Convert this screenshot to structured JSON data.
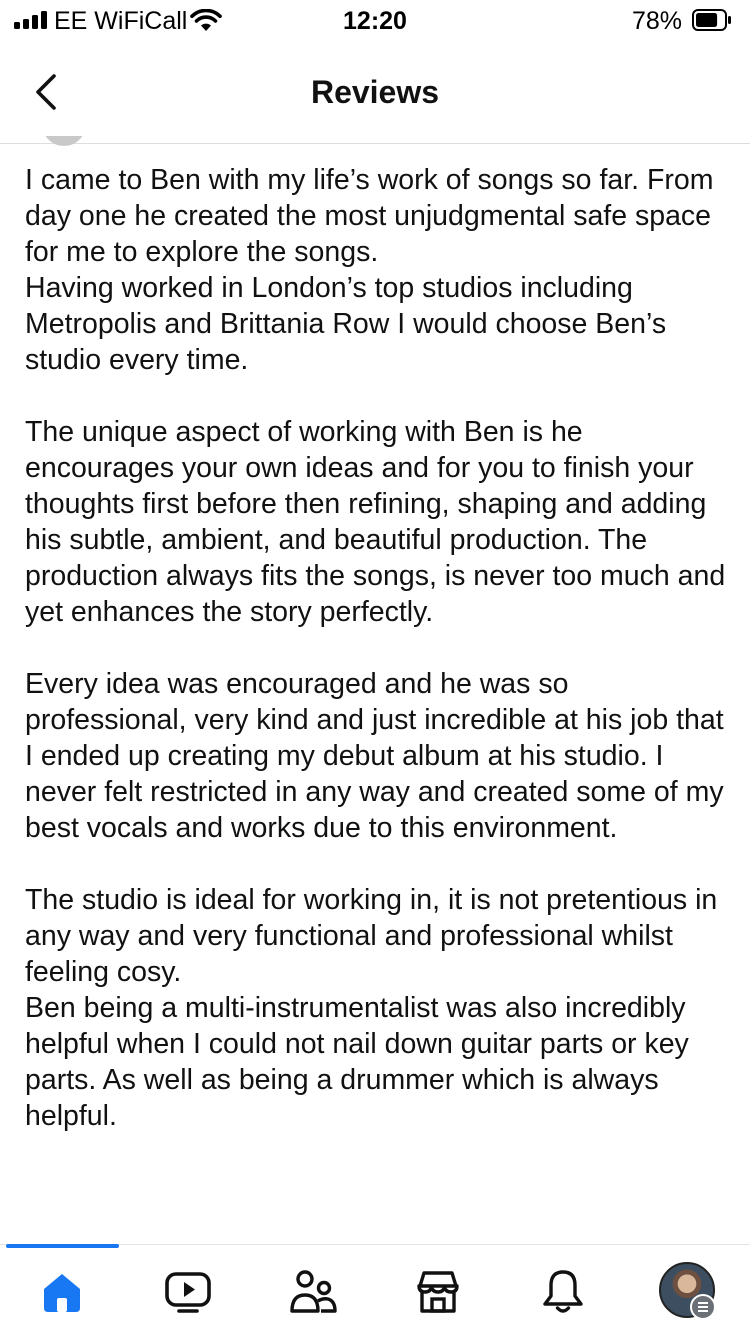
{
  "status_bar": {
    "carrier": "EE WiFiCall",
    "time": "12:20",
    "battery_percent": "78%",
    "battery_level": 0.78,
    "signal_bars": 4
  },
  "nav": {
    "title": "Reviews",
    "back_icon": "chevron-left-icon"
  },
  "review": {
    "paragraphs": [
      "I came to Ben with my life’s work of songs so far. From day one he created the most unjudgmental safe space for me to explore the songs.\nHaving worked in London’s top studios including Metropolis and Brittania Row I would choose Ben’s studio every time.",
      "The unique aspect of working with Ben is he encourages your own ideas and for you to finish your thoughts first before then refining, shaping and adding his subtle, ambient, and beautiful production. The production always fits the songs, is never too much and yet enhances the story perfectly.",
      "Every idea was encouraged and he was so professional, very kind and just incredible at his job that I ended up creating my debut album at his studio. I never felt restricted in any way and created some of my best vocals and works due to this environment.",
      "The studio is ideal for working in, it is not pretentious in any way and very functional and professional whilst feeling cosy.\nBen being a multi-instrumentalist was also incredibly helpful when I could not nail down guitar parts or key parts. As well as being a drummer which is always helpful."
    ]
  },
  "tab_bar": {
    "tabs": [
      {
        "name": "home",
        "icon": "home-icon",
        "active": true
      },
      {
        "name": "video",
        "icon": "video-icon",
        "active": false
      },
      {
        "name": "friends",
        "icon": "friends-icon",
        "active": false
      },
      {
        "name": "marketplace",
        "icon": "marketplace-icon",
        "active": false
      },
      {
        "name": "notifications",
        "icon": "bell-icon",
        "active": false
      },
      {
        "name": "menu",
        "icon": "profile-avatar",
        "active": false
      }
    ]
  },
  "colors": {
    "accent": "#1877f2",
    "text": "#111111",
    "divider": "#dddddd"
  }
}
